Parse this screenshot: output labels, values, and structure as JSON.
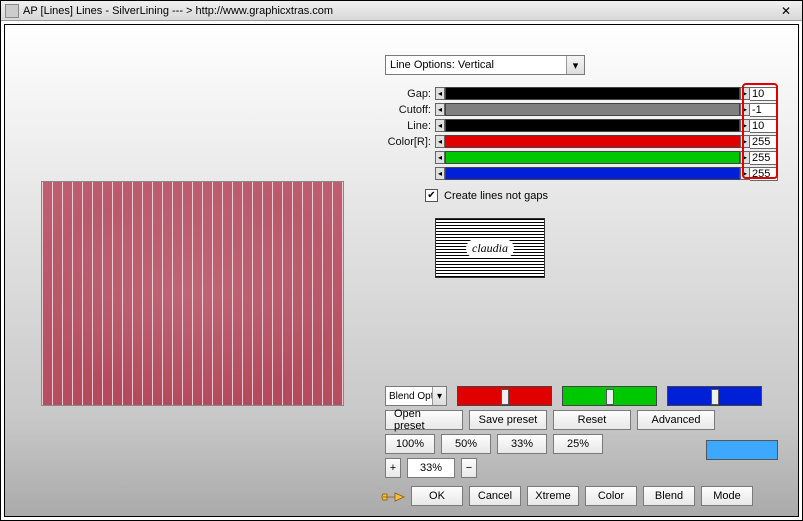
{
  "window": {
    "title": "AP [Lines]  Lines - SilverLining    --- >  http://www.graphicxtras.com"
  },
  "line_options": {
    "selected": "Line Options: Vertical"
  },
  "sliders": {
    "gap": {
      "label": "Gap:",
      "value": "10"
    },
    "cutoff": {
      "label": "Cutoff:",
      "value": "-1"
    },
    "line": {
      "label": "Line:",
      "value": "10"
    },
    "r": {
      "label": "Color[R]:",
      "value": "255"
    },
    "g": {
      "label": "",
      "value": "255"
    },
    "b": {
      "label": "",
      "value": "255"
    }
  },
  "create_lines": {
    "label": "Create lines not gaps",
    "checked": true
  },
  "logo_text": "claudia",
  "blend_dropdown": "Blend Opti",
  "buttons": {
    "open_preset": "Open preset",
    "save_preset": "Save preset",
    "reset": "Reset",
    "advanced": "Advanced",
    "p100": "100%",
    "p50": "50%",
    "p33": "33%",
    "p25": "25%",
    "ok": "OK",
    "cancel": "Cancel",
    "xtreme": "Xtreme",
    "color": "Color",
    "blend": "Blend",
    "mode": "Mode"
  },
  "custom_pct": "33%",
  "swatch_color": "#3da8ff"
}
